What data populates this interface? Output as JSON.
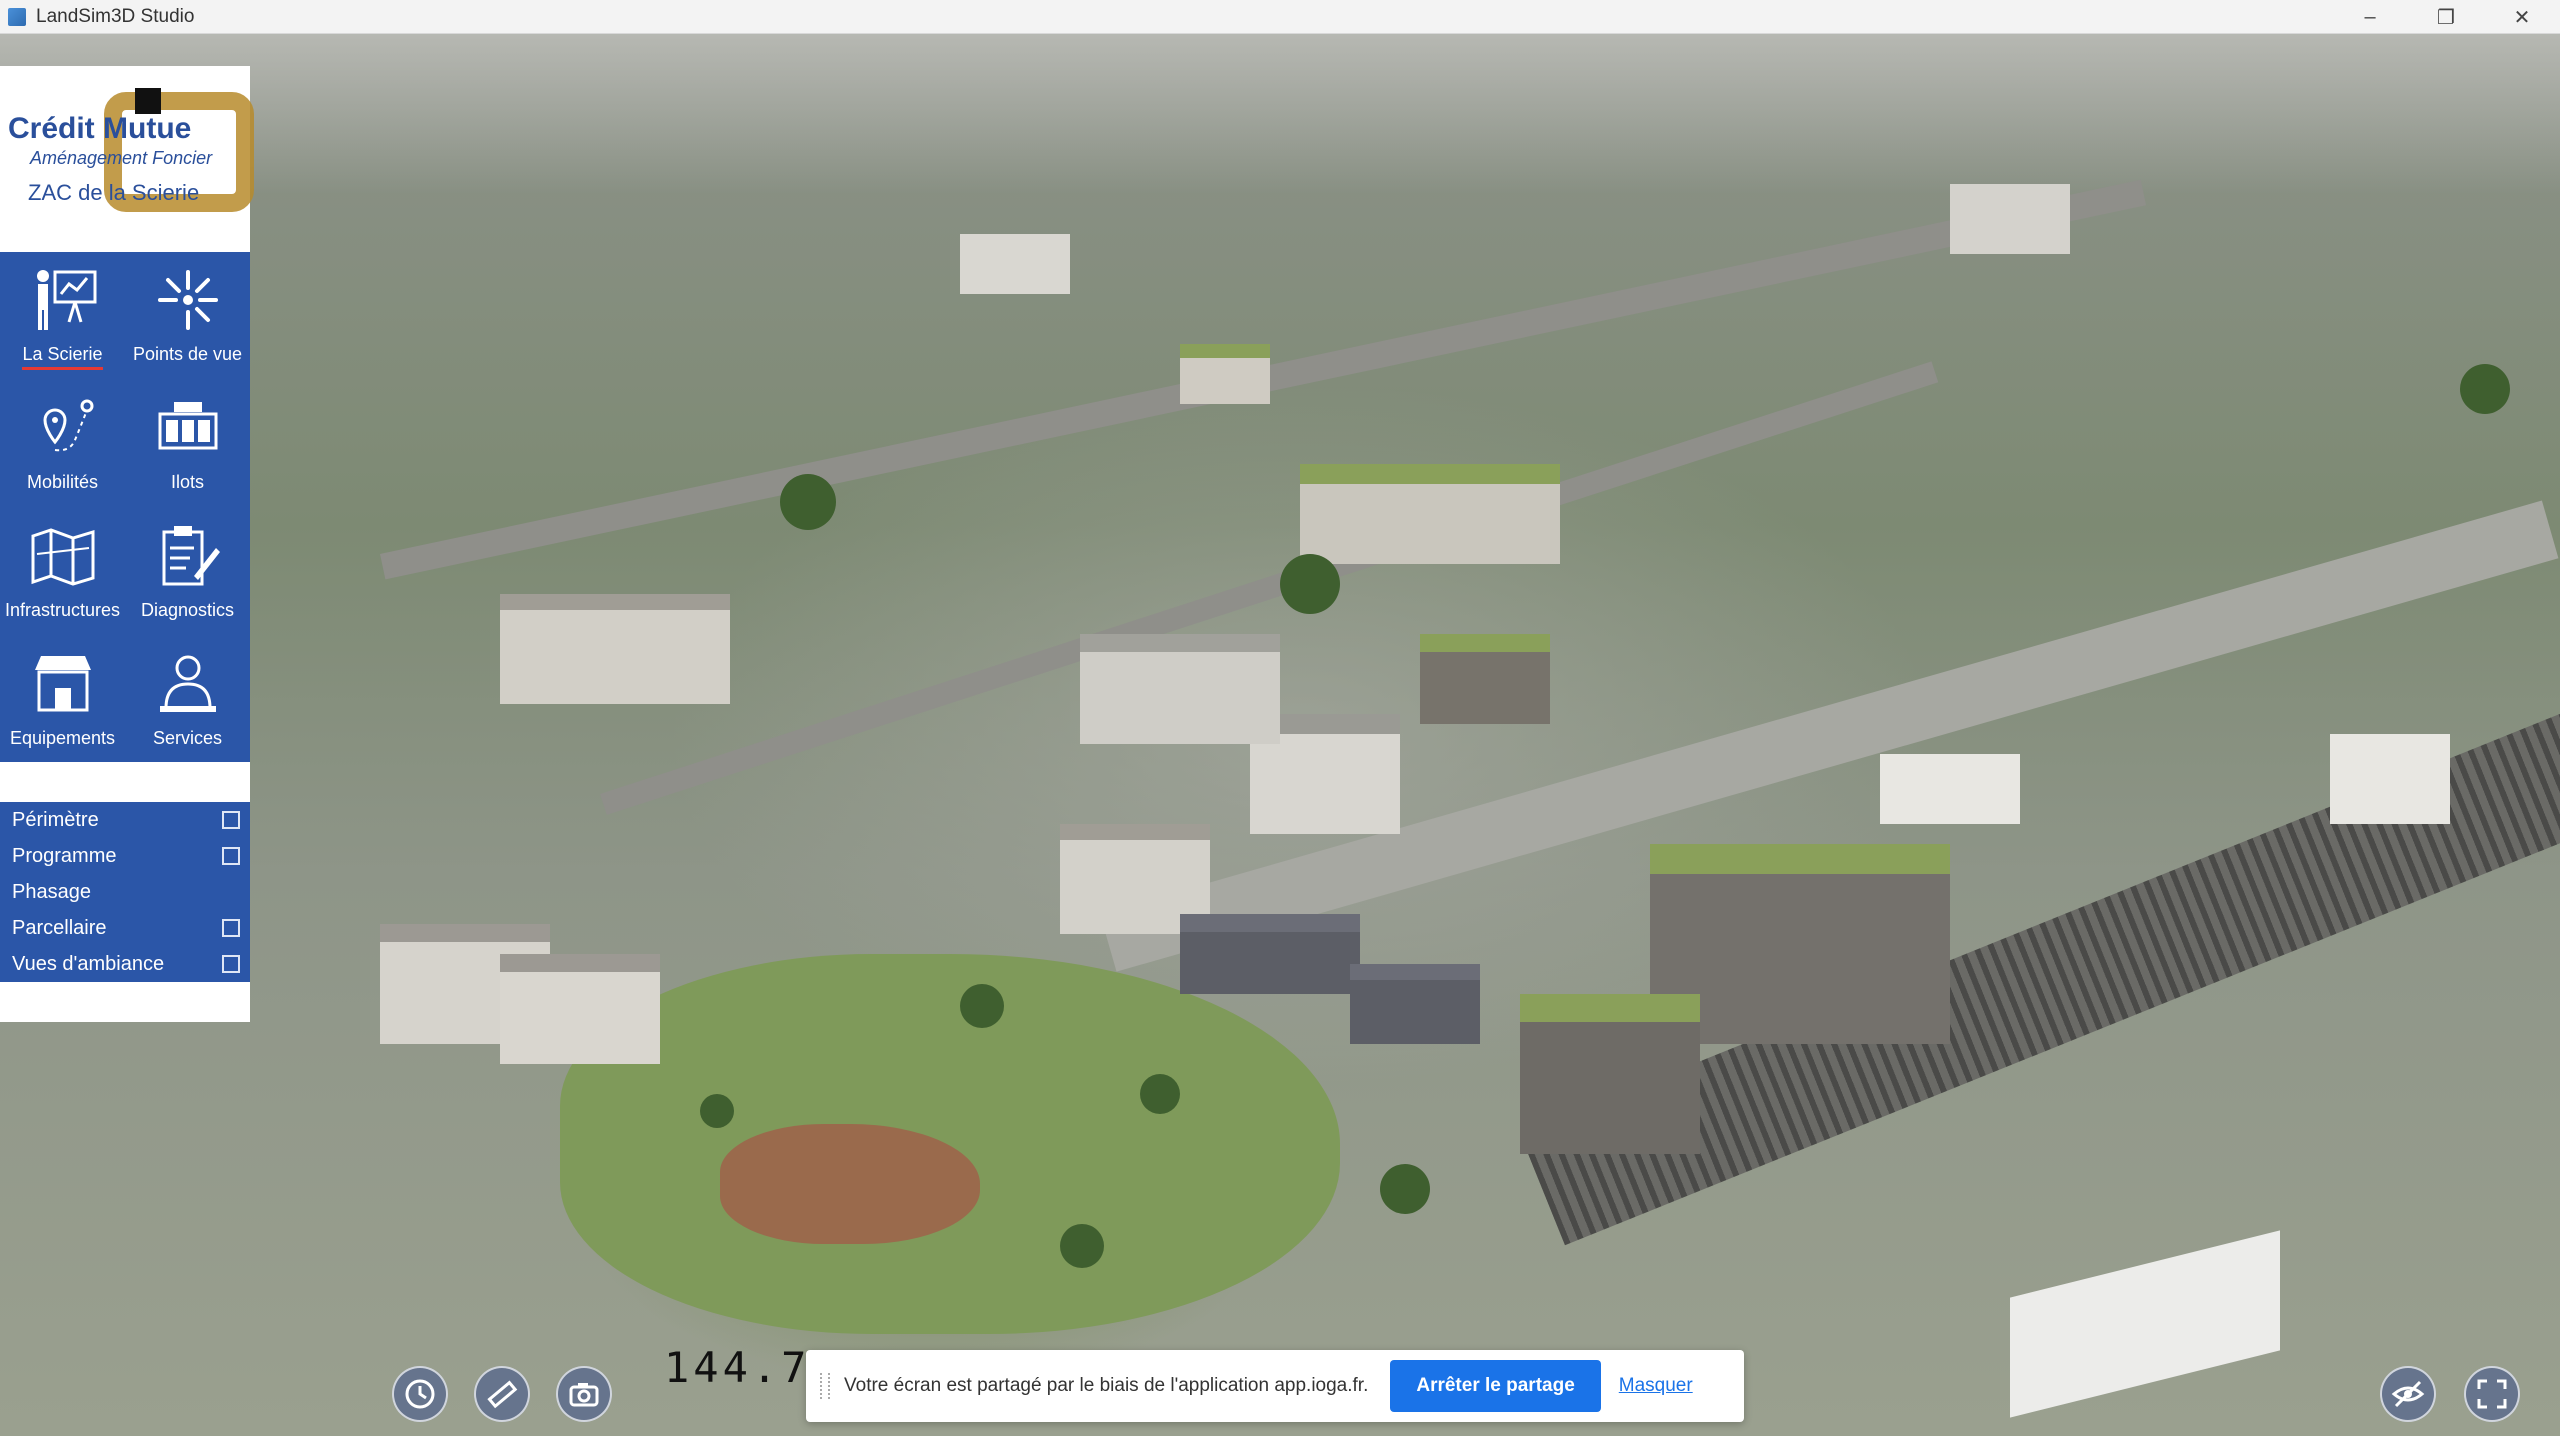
{
  "window": {
    "title": "LandSim3D Studio",
    "controls": [
      "minimize",
      "restore",
      "close"
    ]
  },
  "logo": {
    "line1": "Crédit Mutue",
    "line2": "Aménagement Foncier",
    "line3": "ZAC de la Scierie"
  },
  "tools": [
    {
      "label": "La Scierie",
      "icon": "presentation-icon",
      "active": true
    },
    {
      "label": "Points de vue",
      "icon": "viewpoints-icon",
      "active": false
    },
    {
      "label": "Mobilités",
      "icon": "location-route-icon",
      "active": false
    },
    {
      "label": "Ilots",
      "icon": "blocks-icon",
      "active": false
    },
    {
      "label": "Infrastructures",
      "icon": "map-icon",
      "active": false
    },
    {
      "label": "Diagnostics",
      "icon": "clipboard-icon",
      "active": false
    },
    {
      "label": "Equipements",
      "icon": "store-icon",
      "active": false
    },
    {
      "label": "Services",
      "icon": "person-service-icon",
      "active": false
    }
  ],
  "layers": [
    {
      "label": "Périmètre",
      "has_checkbox": true
    },
    {
      "label": "Programme",
      "has_checkbox": true
    },
    {
      "label": "Phasage",
      "has_checkbox": false
    },
    {
      "label": "Parcellaire",
      "has_checkbox": true
    },
    {
      "label": "Vues d'ambiance",
      "has_checkbox": true
    }
  ],
  "bottom_tools": [
    "clock-icon",
    "measure-ruler-icon",
    "camera-icon"
  ],
  "coordinate_readout": "144.7",
  "share_bar": {
    "message": "Votre écran est partagé par le biais de l'application app.ioga.fr.",
    "stop_label": "Arrêter le partage",
    "hide_label": "Masquer"
  },
  "right_tools": [
    "visibility-off-icon",
    "fullscreen-icon"
  ]
}
